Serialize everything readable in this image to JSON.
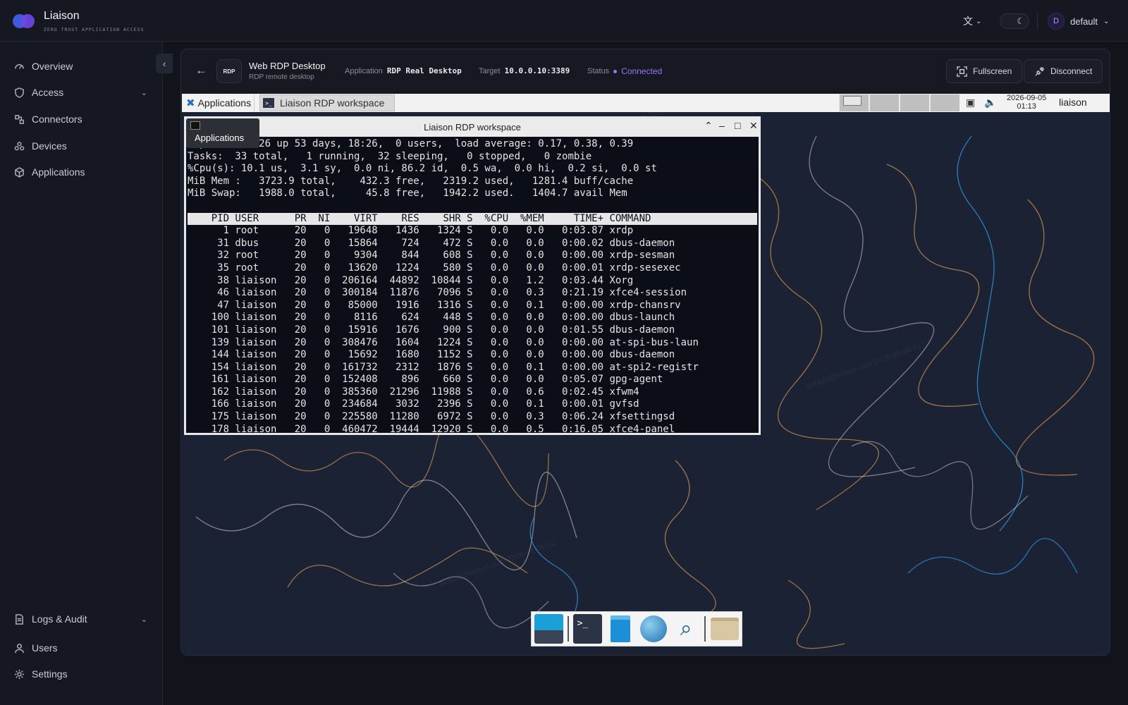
{
  "app": {
    "name": "Liaison",
    "tagline": "ZERO TRUST APPLICATION ACCESS",
    "brand_colors": [
      "#3b5bdb",
      "#7048e8"
    ]
  },
  "topbar": {
    "language_icon": "translate-icon",
    "theme_icon": "moon-icon",
    "user_initial": "D",
    "user_name": "default"
  },
  "sidebar": {
    "items": [
      {
        "label": "Overview",
        "icon": "gauge-icon"
      },
      {
        "label": "Access",
        "icon": "shield-icon",
        "expandable": true
      },
      {
        "label": "Connectors",
        "icon": "connector-icon"
      },
      {
        "label": "Devices",
        "icon": "devices-icon"
      },
      {
        "label": "Applications",
        "icon": "box-icon"
      }
    ],
    "bottom": [
      {
        "label": "Logs & Audit",
        "icon": "log-icon",
        "expandable": true
      },
      {
        "label": "Users",
        "icon": "user-icon"
      },
      {
        "label": "Settings",
        "icon": "gear-icon"
      }
    ]
  },
  "session": {
    "badge": "RDP",
    "title": "Web RDP Desktop",
    "subtitle": "RDP remote desktop",
    "application_label": "Application",
    "application_value": "RDP Real Desktop",
    "target_label": "Target",
    "target_value": "10.0.0.10:3389",
    "status_label": "Status",
    "status_value": "Connected",
    "status_color": "#9775fa",
    "fullscreen_label": "Fullscreen",
    "disconnect_label": "Disconnect"
  },
  "remote": {
    "panel": {
      "apps_label": "Applications",
      "task_label": "Liaison RDP workspace",
      "date": "2026-09-05",
      "time": "01:13",
      "user": "liaison"
    },
    "window_title": "Liaison RDP workspace",
    "apps_popup": "Applications",
    "top": {
      "line1": "top - 01:13:26 up 53 days, 18:26,  0 users,  load average: 0.17, 0.38, 0.39",
      "line2": "Tasks:  33 total,   1 running,  32 sleeping,   0 stopped,   0 zombie",
      "line3": "%Cpu(s): 10.1 us,  3.1 sy,  0.0 ni, 86.2 id,  0.5 wa,  0.0 hi,  0.2 si,  0.0 st",
      "line4": "MiB Mem :   3723.9 total,    432.3 free,   2319.2 used,   1281.4 buff/cache",
      "line5": "MiB Swap:   1988.0 total,     45.8 free,   1942.2 used.   1404.7 avail Mem",
      "header": "    PID USER      PR  NI    VIRT    RES    SHR S  %CPU  %MEM     TIME+ COMMAND      ",
      "rows": [
        "      1 root      20   0   19648   1436   1324 S   0.0   0.0   0:03.87 xrdp",
        "     31 dbus      20   0   15864    724    472 S   0.0   0.0   0:00.02 dbus-daemon",
        "     32 root      20   0    9304    844    608 S   0.0   0.0   0:00.00 xrdp-sesman",
        "     35 root      20   0   13620   1224    580 S   0.0   0.0   0:00.01 xrdp-sesexec",
        "     38 liaison   20   0  206164  44892  10844 S   0.0   1.2   0:03.44 Xorg",
        "     46 liaison   20   0  300184  11876   7096 S   0.0   0.3   0:21.19 xfce4-session",
        "     47 liaison   20   0   85000   1916   1316 S   0.0   0.1   0:00.00 xrdp-chansrv",
        "    100 liaison   20   0    8116    624    448 S   0.0   0.0   0:00.00 dbus-launch",
        "    101 liaison   20   0   15916   1676    900 S   0.0   0.0   0:01.55 dbus-daemon",
        "    139 liaison   20   0  308476   1604   1224 S   0.0   0.0   0:00.00 at-spi-bus-laun",
        "    144 liaison   20   0   15692   1680   1152 S   0.0   0.0   0:00.00 dbus-daemon",
        "    154 liaison   20   0  161732   2312   1876 S   0.0   0.1   0:00.00 at-spi2-registr",
        "    161 liaison   20   0  152408    896    660 S   0.0   0.0   0:05.07 gpg-agent",
        "    162 liaison   20   0  385360  21296  11988 S   0.0   0.6   0:02.45 xfwm4",
        "    166 liaison   20   0  234684   3032   2396 S   0.0   0.1   0:00.01 gvfsd",
        "    175 liaison   20   0  225580  11280   6972 S   0.0   0.3   0:06.24 xfsettingsd",
        "    178 liaison   20   0  460472  19444  12920 S   0.0   0.5   0:16.05 xfce4-panel"
      ]
    },
    "dock_icons": [
      "show-desktop-icon",
      "terminal-icon",
      "file-manager-icon",
      "web-browser-icon",
      "search-icon",
      "folder-icon"
    ],
    "watermark": "default@liaison.com 2026-09-05 01:"
  }
}
